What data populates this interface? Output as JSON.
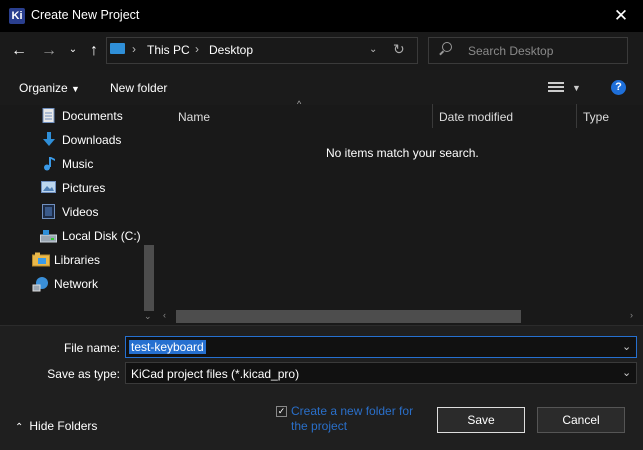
{
  "window": {
    "title": "Create New Project",
    "app_icon_text": "Ki"
  },
  "address_bar": {
    "crumbs": [
      "This PC",
      "Desktop"
    ],
    "search_placeholder": "Search Desktop"
  },
  "toolbar": {
    "organize_label": "Organize",
    "new_folder_label": "New folder"
  },
  "sidebar": {
    "items": [
      {
        "label": "Documents",
        "icon": "documents-icon"
      },
      {
        "label": "Downloads",
        "icon": "downloads-icon"
      },
      {
        "label": "Music",
        "icon": "music-icon"
      },
      {
        "label": "Pictures",
        "icon": "pictures-icon"
      },
      {
        "label": "Videos",
        "icon": "videos-icon"
      },
      {
        "label": "Local Disk (C:)",
        "icon": "disk-icon"
      },
      {
        "label": "Libraries",
        "icon": "libraries-icon"
      },
      {
        "label": "Network",
        "icon": "network-icon"
      }
    ]
  },
  "file_list": {
    "columns": [
      "Name",
      "Date modified",
      "Type"
    ],
    "empty_message": "No items match your search."
  },
  "form": {
    "file_name_label": "File name:",
    "file_name_value": "test-keyboard",
    "save_as_type_label": "Save as type:",
    "save_as_type_value": "KiCad project files (*.kicad_pro)"
  },
  "footer": {
    "hide_folders_label": "Hide Folders",
    "create_folder_label": "Create a new folder for the project",
    "create_folder_checked": true,
    "save_label": "Save",
    "cancel_label": "Cancel"
  },
  "colors": {
    "accent": "#2670d0",
    "link": "#2a6fc9",
    "background": "#191919"
  }
}
